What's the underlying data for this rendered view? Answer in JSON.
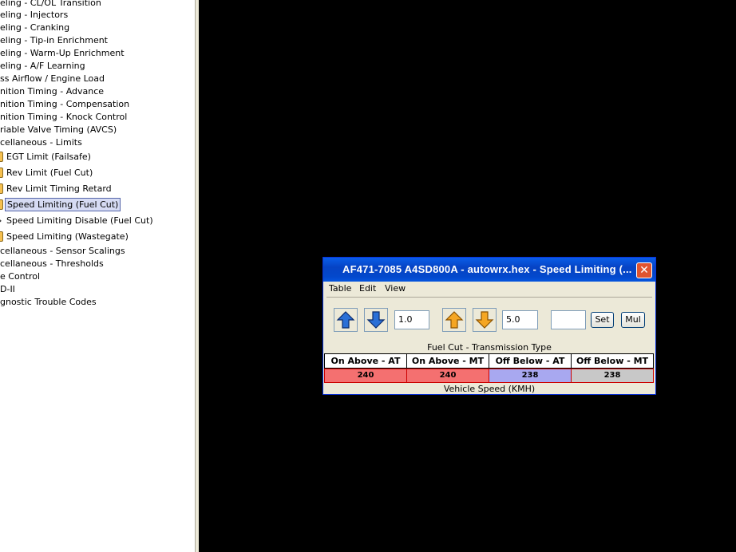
{
  "tree": {
    "items": [
      {
        "label": "eling - CL/OL Transition"
      },
      {
        "label": "eling - Injectors"
      },
      {
        "label": "eling - Cranking"
      },
      {
        "label": "eling - Tip-in Enrichment"
      },
      {
        "label": "eling - Warm-Up Enrichment"
      },
      {
        "label": "eling - A/F Learning"
      },
      {
        "label": "ss Airflow / Engine Load"
      },
      {
        "label": "nition Timing - Advance"
      },
      {
        "label": "nition Timing - Compensation"
      },
      {
        "label": "nition Timing - Knock Control"
      },
      {
        "label": "riable Valve Timing (AVCS)"
      },
      {
        "label": "cellaneous - Limits"
      },
      {
        "label": "EGT Limit (Failsafe)"
      },
      {
        "label": "Rev Limit (Fuel Cut)"
      },
      {
        "label": "Rev Limit Timing Retard"
      },
      {
        "label": "Speed Limiting (Fuel Cut)"
      },
      {
        "label": "Speed Limiting Disable (Fuel Cut)"
      },
      {
        "label": "Speed Limiting (Wastegate)"
      },
      {
        "label": "cellaneous - Sensor Scalings"
      },
      {
        "label": "cellaneous - Thresholds"
      },
      {
        "label": "e Control"
      },
      {
        "label": "D-II"
      },
      {
        "label": "gnostic Trouble Codes"
      }
    ]
  },
  "window": {
    "title": "AF471-7085 A4SD800A - autowrx.hex - Speed Limiting (...",
    "close_glyph": "✕",
    "menu": {
      "table": "Table",
      "edit": "Edit",
      "view": "View"
    },
    "toolbar": {
      "increment_value": "1.0",
      "multiply_value": "5.0",
      "set_input_value": "",
      "set_label": "Set",
      "mul_label": "Mul"
    },
    "table": {
      "x_axis_title": "Fuel Cut - Transmission Type",
      "headers": [
        "On Above - AT",
        "On Above - MT",
        "Off Below - AT",
        "Off Below - MT"
      ],
      "values": [
        "240",
        "240",
        "238",
        "238"
      ],
      "cell_colors": [
        "#f47070",
        "#f47070",
        "#a8a8f0",
        "#c8c8c8"
      ],
      "y_axis_title": "Vehicle Speed (KMH)"
    }
  }
}
